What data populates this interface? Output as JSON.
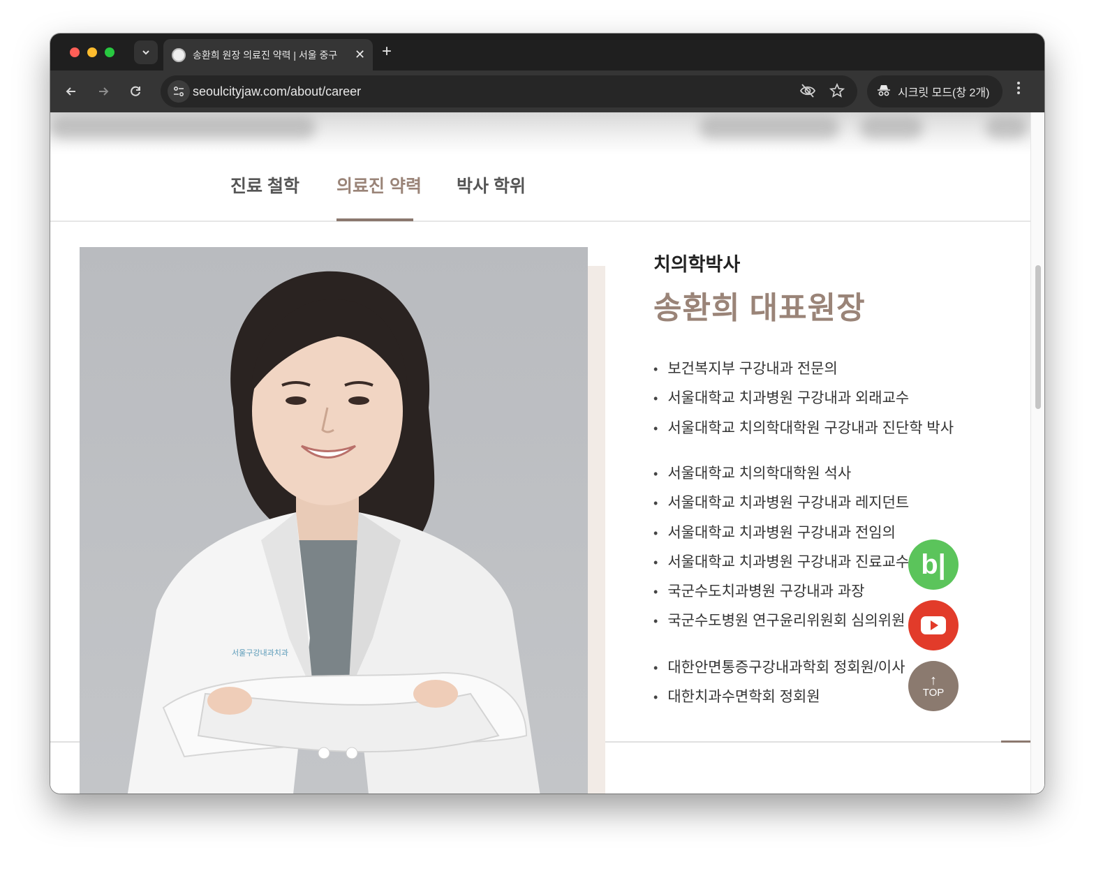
{
  "browser": {
    "tab_title": "송환희 원장 의료진 약력 | 서울 중구",
    "url": "seoulcityjaw.com/about/career",
    "incognito_label": "시크릿 모드(창 2개)",
    "new_tab": "+",
    "tab_close": "✕"
  },
  "icons": {
    "tab_search": "chevron-down-icon",
    "back": "arrow-left-icon",
    "forward": "arrow-right-icon",
    "reload": "reload-icon",
    "site_info": "tune-icon",
    "eye_off": "eye-off-icon",
    "bookmark": "star-icon",
    "incognito": "incognito-icon",
    "menu": "kebab-menu-icon"
  },
  "subnav": {
    "items": [
      "진료 철학",
      "의료진 약력",
      "박사 학위"
    ],
    "active_index": 1
  },
  "profile": {
    "degree": "치의학박사",
    "name": "송환희 대표원장",
    "photo_badge": "서울구강내과치과"
  },
  "career": {
    "group1": [
      "보건복지부 구강내과 전문의",
      "서울대학교 치과병원 구강내과 외래교수",
      "서울대학교 치의학대학원 구강내과 진단학 박사"
    ],
    "group2": [
      "서울대학교 치의학대학원 석사",
      "서울대학교 치과병원 구강내과 레지던트",
      "서울대학교 치과병원 구강내과 전임의",
      "서울대학교 치과병원 구강내과 진료교수",
      "국군수도치과병원 구강내과 과장",
      "국군수도병원 연구윤리위원회 심의위원"
    ],
    "group3": [
      "대한안면통증구강내과학회 정회원/이사",
      "대한치과수면학회 정회원"
    ]
  },
  "floating": {
    "blog_label": "b|",
    "top_label": "TOP",
    "top_arrow": "↑"
  },
  "colors": {
    "accent": "#9a8478",
    "underline": "#8b786e",
    "blog": "#5bc45b",
    "youtube": "#e23b2a",
    "top_button": "#8b7a6f"
  }
}
